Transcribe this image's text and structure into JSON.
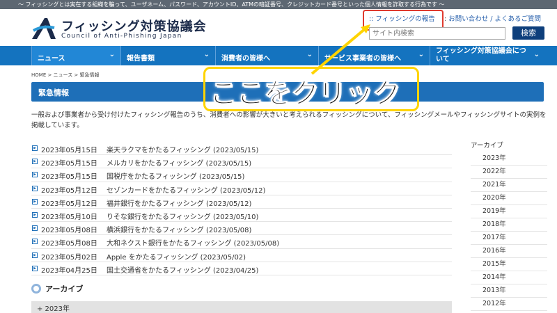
{
  "topbar": {
    "text": "〜 フィッシングとは実在する組織を騙って、ユーザネーム、パスワード、アカウントID、ATMの暗証番号、クレジットカード番号といった個人情報を詐取する行為です 〜"
  },
  "logo": {
    "jp": "フィッシング対策協議会",
    "en": "Council of Anti-Phishing Japan"
  },
  "util": {
    "prefix1": ":: ",
    "report": "フィッシングの報告",
    "prefix2": ": ",
    "contact": "お問い合わせ",
    "slash": " / ",
    "faq": "よくあるご質問"
  },
  "search": {
    "placeholder": "サイト内検索",
    "button": "検索"
  },
  "nav": [
    {
      "label": "ニュース"
    },
    {
      "label": "報告書類"
    },
    {
      "label": "消費者の皆様へ"
    },
    {
      "label": "サービス事業者の皆様へ"
    },
    {
      "label": "フィッシング対策協議会について"
    }
  ],
  "breadcrumb": "HOME > ニュース > 緊急情報",
  "page_title": "緊急情報",
  "callout": "ここをクリック",
  "description": "一般および事業者から受け付けたフィッシング報告のうち、消費者への影響が大きいと考えられるフィッシングについて、フィッシングメールやフィッシングサイトの実例を掲載しています。",
  "items": [
    {
      "date": "2023年05月15日",
      "title": "楽天ラクマをかたるフィッシング (2023/05/15)"
    },
    {
      "date": "2023年05月15日",
      "title": "メルカリをかたるフィッシング (2023/05/15)"
    },
    {
      "date": "2023年05月15日",
      "title": "国税庁をかたるフィッシング (2023/05/15)"
    },
    {
      "date": "2023年05月12日",
      "title": "セゾンカードをかたるフィッシング (2023/05/12)"
    },
    {
      "date": "2023年05月12日",
      "title": "福井銀行をかたるフィッシング (2023/05/12)"
    },
    {
      "date": "2023年05月10日",
      "title": "りそな銀行をかたるフィッシング (2023/05/10)"
    },
    {
      "date": "2023年05月08日",
      "title": "横浜銀行をかたるフィッシング (2023/05/08)"
    },
    {
      "date": "2023年05月08日",
      "title": "大和ネクスト銀行をかたるフィッシング (2023/05/08)"
    },
    {
      "date": "2023年05月02日",
      "title": "Apple をかたるフィッシング (2023/05/02)"
    },
    {
      "date": "2023年04月25日",
      "title": "国土交通省をかたるフィッシング (2023/04/25)"
    }
  ],
  "archive": {
    "heading": "アーカイブ",
    "year_toggle": "+ 2023年"
  },
  "sidebar": {
    "heading": "アーカイブ",
    "years": [
      "2023年",
      "2022年",
      "2021年",
      "2020年",
      "2019年",
      "2018年",
      "2017年",
      "2016年",
      "2015年",
      "2014年",
      "2013年",
      "2012年"
    ]
  },
  "colors": {
    "nav": "#1473bf",
    "title_bar": "#1e6fb8",
    "highlight": "#e03a2e",
    "callout_border": "#ffd400",
    "link": "#2a62ad"
  }
}
